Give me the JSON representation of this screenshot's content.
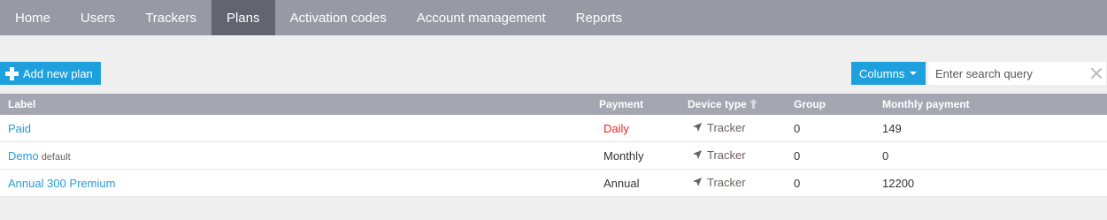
{
  "nav": [
    {
      "label": "Home",
      "active": false
    },
    {
      "label": "Users",
      "active": false
    },
    {
      "label": "Trackers",
      "active": false
    },
    {
      "label": "Plans",
      "active": true
    },
    {
      "label": "Activation codes",
      "active": false
    },
    {
      "label": "Account management",
      "active": false
    },
    {
      "label": "Reports",
      "active": false
    }
  ],
  "toolbar": {
    "add_label": "Add new plan",
    "columns_label": "Columns",
    "search_placeholder": "Enter search query"
  },
  "table": {
    "headers": {
      "label": "Label",
      "payment": "Payment",
      "device_type": "Device type",
      "group": "Group",
      "monthly": "Monthly payment"
    },
    "rows": [
      {
        "label": "Paid",
        "tag": "",
        "payment": "Daily",
        "device": "Tracker",
        "group": "0",
        "monthly": "149"
      },
      {
        "label": "Demo",
        "tag": "default",
        "payment": "Monthly",
        "device": "Tracker",
        "group": "0",
        "monthly": "0"
      },
      {
        "label": "Annual 300 Premium",
        "tag": "",
        "payment": "Annual",
        "device": "Tracker",
        "group": "0",
        "monthly": "12200"
      }
    ]
  },
  "colors": {
    "nav_bg": "#979aa4",
    "nav_active": "#62656f",
    "accent": "#1ea0dc",
    "link": "#2a9ad7",
    "alert": "#e02a2a"
  }
}
